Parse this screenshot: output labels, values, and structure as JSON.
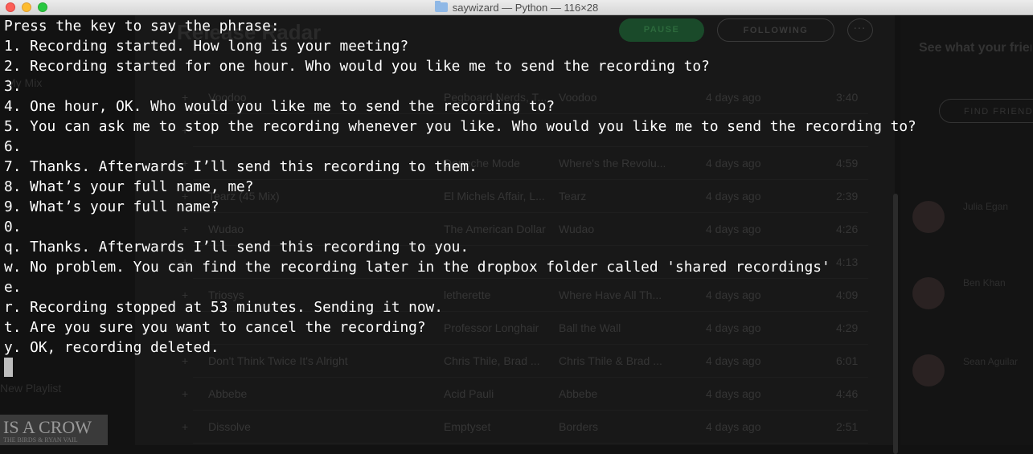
{
  "window": {
    "title": "saywizard — Python — 116×28"
  },
  "terminal": {
    "lines": [
      "Press the key to say the phrase:",
      "1. Recording started. How long is your meeting?",
      "2. Recording started for one hour. Who would you like me to send the recording to?",
      "3.",
      "4. One hour, OK. Who would you like me to send the recording to?",
      "5. You can ask me to stop the recording whenever you like. Who would you like me to send the recording to?",
      "6.",
      "7. Thanks. Afterwards I’ll send this recording to them.",
      "8. What’s your full name, me?",
      "9. What’s your full name?",
      "0.",
      "q. Thanks. Afterwards I’ll send this recording to you.",
      "w. No problem. You can find the recording later in the dropbox folder called 'shared recordings'",
      "e.",
      "r. Recording stopped at 53 minutes. Sending it now.",
      "t. Are you sure you want to cancel the recording?",
      "y. OK, recording deleted."
    ]
  },
  "background_app": {
    "title": "Release Radar",
    "pause_label": "PAUSE",
    "following_label": "FOLLOWING",
    "more_label": "···",
    "sidebar": [
      "My Mix",
      "New Playlist"
    ],
    "friends_heading": "See what your friends are playing",
    "find_friends_label": "FIND FRIENDS",
    "friends": [
      "Julia Egan",
      "Ben Khan",
      "Sean Aguilar"
    ],
    "album_art_text": "IS A CROW",
    "album_art_sub": "THE BIRDS & RYAN VAIL",
    "tracks": [
      {
        "title": "Voodoo",
        "artist": "Pegboard Nerds, T...",
        "album": "Voodoo",
        "added": "4 days ago",
        "time": "3:40"
      },
      {
        "title": "",
        "artist": "",
        "album": "",
        "added": "",
        "time": ""
      },
      {
        "title": "",
        "artist": "Depeche Mode",
        "album": "Where's the Revolu...",
        "added": "4 days ago",
        "time": "4:59"
      },
      {
        "title": "Tearz (45 Mix)",
        "artist": "El Michels Affair, L...",
        "album": "Tearz",
        "added": "4 days ago",
        "time": "2:39"
      },
      {
        "title": "Wudao",
        "artist": "The American Dollar",
        "album": "Wudao",
        "added": "4 days ago",
        "time": "4:26"
      },
      {
        "title": "",
        "artist": "",
        "album": "",
        "added": "",
        "time": "4:13"
      },
      {
        "title": "Triosys",
        "artist": "letherette",
        "album": "Where Have All Th...",
        "added": "4 days ago",
        "time": "4:09"
      },
      {
        "title": "",
        "artist": "Professor Longhair",
        "album": "Ball the Wall",
        "added": "4 days ago",
        "time": "4:29"
      },
      {
        "title": "Don't Think Twice It's Alright",
        "artist": "Chris Thile, Brad ...",
        "album": "Chris Thile & Brad ...",
        "added": "4 days ago",
        "time": "6:01"
      },
      {
        "title": "Abbebe",
        "artist": "Acid Pauli",
        "album": "Abbebe",
        "added": "4 days ago",
        "time": "4:46"
      },
      {
        "title": "Dissolve",
        "artist": "Emptyset",
        "album": "Borders",
        "added": "4 days ago",
        "time": "2:51"
      }
    ]
  }
}
